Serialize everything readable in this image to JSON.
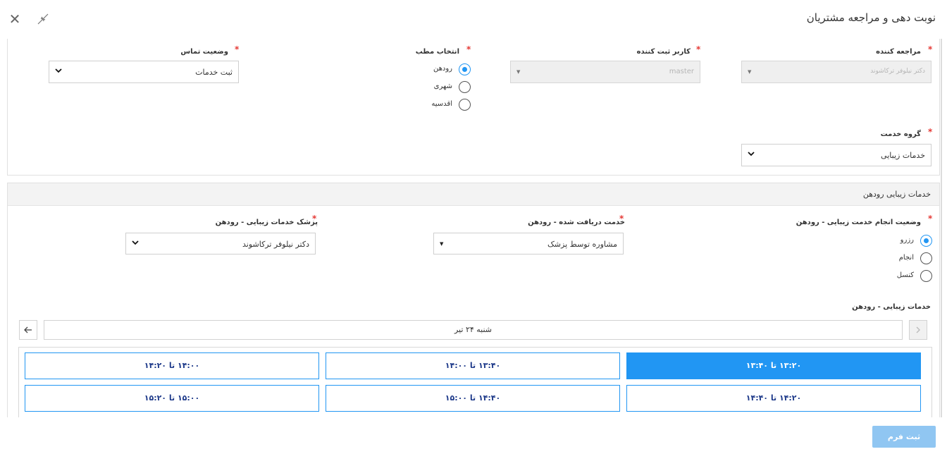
{
  "header": {
    "title": "نوبت دهی و مراجعه مشتریان",
    "close_icon": "close-icon",
    "collapse_icon": "collapse-icon"
  },
  "form": {
    "referrer": {
      "label": "مراجعه کننده",
      "value": "دکتر نیلوفر ترکاشوند"
    },
    "registering_user": {
      "label": "کاربر ثبت کننده",
      "value": "master"
    },
    "clinic_selection": {
      "label": "انتخاب مطب",
      "options": [
        "رودهن",
        "شهری",
        "اقدسیه"
      ],
      "selected": "رودهن"
    },
    "contact_status": {
      "label": "وضعیت تماس",
      "value": "ثبت خدمات"
    },
    "service_group": {
      "label": "گروه خدمت",
      "value": "خدمات زیبایی"
    }
  },
  "services_panel": {
    "title": "خدمات زیبایی رودهن",
    "status": {
      "label": "وضعیت انجام خدمت زیبایی - رودهن",
      "options": [
        "رزرو",
        "انجام",
        "کنسل"
      ],
      "selected": "رزرو"
    },
    "received_service": {
      "label": "خدمت دریافت شده - رودهن",
      "value": "مشاوره توسط پزشک"
    },
    "doctor": {
      "label": "پزشک خدمات زیبایی - رودهن",
      "value": "دکتر نیلوفر ترکاشوند"
    },
    "schedule_label": "خدمات زیبایی - رودهن",
    "date": "شنبه ۲۴ تیر",
    "slots": [
      "۱۳:۲۰ تا ۱۳:۴۰",
      "۱۳:۴۰ تا ۱۴:۰۰",
      "۱۴:۰۰ تا ۱۴:۲۰",
      "۱۴:۲۰ تا ۱۴:۴۰",
      "۱۴:۴۰ تا ۱۵:۰۰",
      "۱۵:۰۰ تا ۱۵:۲۰"
    ],
    "selected_slot": "۱۳:۲۰ تا ۱۳:۴۰"
  },
  "footer": {
    "submit_label": "ثبت فرم"
  },
  "colors": {
    "accent": "#2196f3",
    "required": "#e53935",
    "submit": "#90c6f2"
  }
}
